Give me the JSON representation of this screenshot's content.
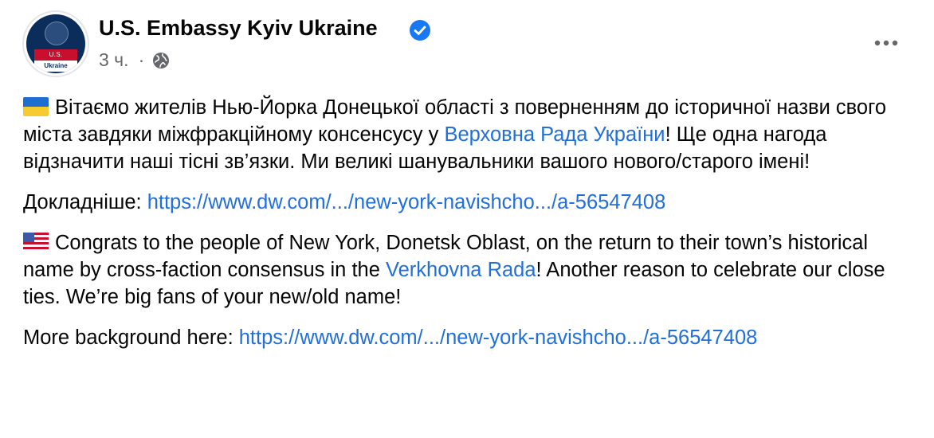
{
  "header": {
    "page_name": "U.S. Embassy Kyiv Ukraine",
    "time": "3 ч.",
    "separator": "·",
    "avatar_top_text": "U.S. EMBASSY",
    "avatar_bottom_text": "Ukraine"
  },
  "icons": {
    "verified": "verified-badge-icon",
    "globe": "globe-icon",
    "more": "more-options-icon",
    "flag_ua": "ukraine-flag-icon",
    "flag_us": "us-flag-icon"
  },
  "colors": {
    "link": "#216fdb",
    "verified": "#1877f2",
    "meta": "#65676b",
    "text": "#050505"
  },
  "post": {
    "p1_text1": "Вітаємо жителів Нью-Йорка Донецької області з поверненням до історичної назви свого міста завдяки міжфракційному консенсусу у ",
    "p1_link": "Верховна Рада України",
    "p1_text2": "! Ще одна нагода відзначити наші тісні зв’язки. Ми великі шанувальники вашого нового/старого імені!",
    "p2_label": "Докладніше: ",
    "p2_link": "https://www.dw.com/.../new-york-navishcho.../a-56547408",
    "p3_text1": "Congrats to the people of New York, Donetsk Oblast, on the return to their town’s historical name by cross-faction consensus in the ",
    "p3_link": "Verkhovna Rada",
    "p3_text2": "! Another reason to celebrate our close ties. We’re big fans of your new/old name!",
    "p4_label": "More background here: ",
    "p4_link": "https://www.dw.com/.../new-york-navishcho.../a-56547408"
  }
}
